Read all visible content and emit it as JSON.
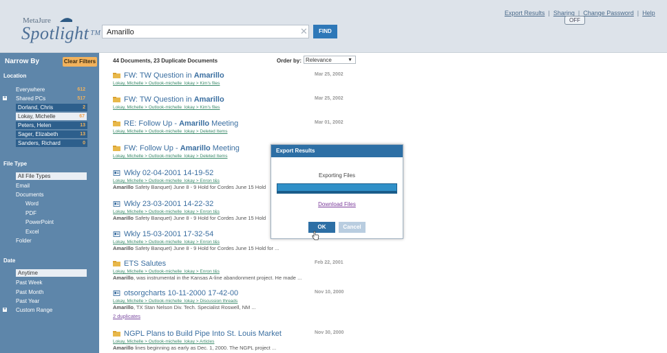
{
  "header": {
    "logo_small": "MetaJure",
    "logo_big": "Spotlight",
    "logo_tm": "TM",
    "search_value": "Amarillo",
    "clear_glyph": "✕",
    "find_label": "FIND",
    "links": {
      "export": "Export Results",
      "sharing": "Sharing",
      "change_password": "Change Password",
      "help": "Help",
      "sep": "|"
    },
    "sharing_toggle": "OFF"
  },
  "sidebar": {
    "narrow_by": "Narrow By",
    "clear_filters": "Clear Filters",
    "location_title": "Location",
    "locations": [
      {
        "label": "Everywhere",
        "count": "612"
      },
      {
        "label": "Shared PCs",
        "count": "517"
      },
      {
        "label": "Dorland, Chris",
        "count": "2"
      },
      {
        "label": "Lokay, Michelle",
        "count": "67"
      },
      {
        "label": "Peters, Helen",
        "count": "13"
      },
      {
        "label": "Sager, Elizabeth",
        "count": "13"
      },
      {
        "label": "Sanders, Richard",
        "count": "0"
      }
    ],
    "filetype_title": "File Type",
    "filetypes": [
      "All File Types",
      "Email",
      "Documents",
      "Word",
      "PDF",
      "PowerPoint",
      "Excel",
      "Folder"
    ],
    "date_title": "Date",
    "dates": [
      "Anytime",
      "Past Week",
      "Past Month",
      "Past Year",
      "Custom Range"
    ]
  },
  "results": {
    "summary": "44 Documents, 23 Duplicate Documents",
    "order_by_label": "Order by:",
    "order_by_value": "Relevance",
    "items": [
      {
        "pre": "FW: TW Question in ",
        "bold": "Amarillo",
        "post": "",
        "date": "Mar 25, 2002",
        "path": [
          "Lokay, Michelle",
          "Outlook-michelle_lokay",
          "Kim's files"
        ],
        "snippet_bold": "",
        "snippet": ""
      },
      {
        "pre": "FW: TW Question in ",
        "bold": "Amarillo",
        "post": "",
        "date": "Mar 25, 2002",
        "path": [
          "Lokay, Michelle",
          "Outlook-michelle_lokay",
          "Kim's files"
        ],
        "snippet_bold": "",
        "snippet": ""
      },
      {
        "pre": "RE: Follow Up - ",
        "bold": "Amarillo",
        "post": " Meeting",
        "date": "Mar 01, 2002",
        "path": [
          "Lokay, Michelle",
          "Outlook-michelle_lokay",
          "Deleted Items"
        ],
        "snippet_bold": "",
        "snippet": ""
      },
      {
        "pre": "FW: Follow Up - ",
        "bold": "Amarillo",
        "post": " Meeting",
        "date": "",
        "path": [
          "Lokay, Michelle",
          "Outlook-michelle_lokay",
          "Deleted Items"
        ],
        "snippet_bold": "",
        "snippet": ""
      },
      {
        "pre": "Wkly 02-04-2001 14-19-52",
        "bold": "",
        "post": "",
        "date": "",
        "path": [
          "Lokay, Michelle",
          "Outlook-michelle_lokay",
          "Enron t&s"
        ],
        "snippet_bold": "Amarillo",
        "snippet": " Safety Banquet) June 8 - 9 Hold for Cordes June 15 Hold"
      },
      {
        "pre": "Wkly 23-03-2001 14-22-32",
        "bold": "",
        "post": "",
        "date": "",
        "path": [
          "Lokay, Michelle",
          "Outlook-michelle_lokay",
          "Enron t&s"
        ],
        "snippet_bold": "Amarillo",
        "snippet": " Safety Banquet) June 8 - 9 Hold for Cordes June 15 Hold"
      },
      {
        "pre": "Wkly 15-03-2001 17-32-54",
        "bold": "",
        "post": "",
        "date": "",
        "path": [
          "Lokay, Michelle",
          "Outlook-michelle_lokay",
          "Enron t&s"
        ],
        "snippet_bold": "Amarillo",
        "snippet": " Safety Banquet) June 8 - 9 Hold for Cordes June 15 Hold for ..."
      },
      {
        "pre": "ETS Salutes",
        "bold": "",
        "post": "",
        "date": "Feb 22, 2001",
        "path": [
          "Lokay, Michelle",
          "Outlook-michelle_lokay",
          "Enron t&s"
        ],
        "snippet_bold": "Amarillo",
        "snippet": ", was instrumental in the Kansas A-line abandonment project. He made ..."
      },
      {
        "pre": "otsorgcharts 10-11-2000 17-42-00",
        "bold": "",
        "post": "",
        "date": "Nov 10, 2000",
        "path": [
          "Lokay, Michelle",
          "Outlook-michelle_lokay",
          "Discussion threads"
        ],
        "snippet_bold": "Amarillo",
        "snippet": ", TX Stan Nelson Div. Tech. Specialist Roswell, NM ...",
        "dups": "2 duplicates"
      },
      {
        "pre": "NGPL Plans to Build Pipe Into St. Louis Market",
        "bold": "",
        "post": "",
        "date": "Nov 30, 2000",
        "path": [
          "Lokay, Michelle",
          "Outlook-michelle_lokay",
          "Articles"
        ],
        "snippet_bold": "Amarillo",
        "snippet": " lines beginning as early as Dec. 1, 2000. The NGPL project ..."
      }
    ],
    "path_sep": ">"
  },
  "modal": {
    "title": "Export Results",
    "message": "Exporting Files",
    "progress": 1.0,
    "download_link": "Download Files",
    "ok": "OK",
    "cancel": "Cancel"
  }
}
